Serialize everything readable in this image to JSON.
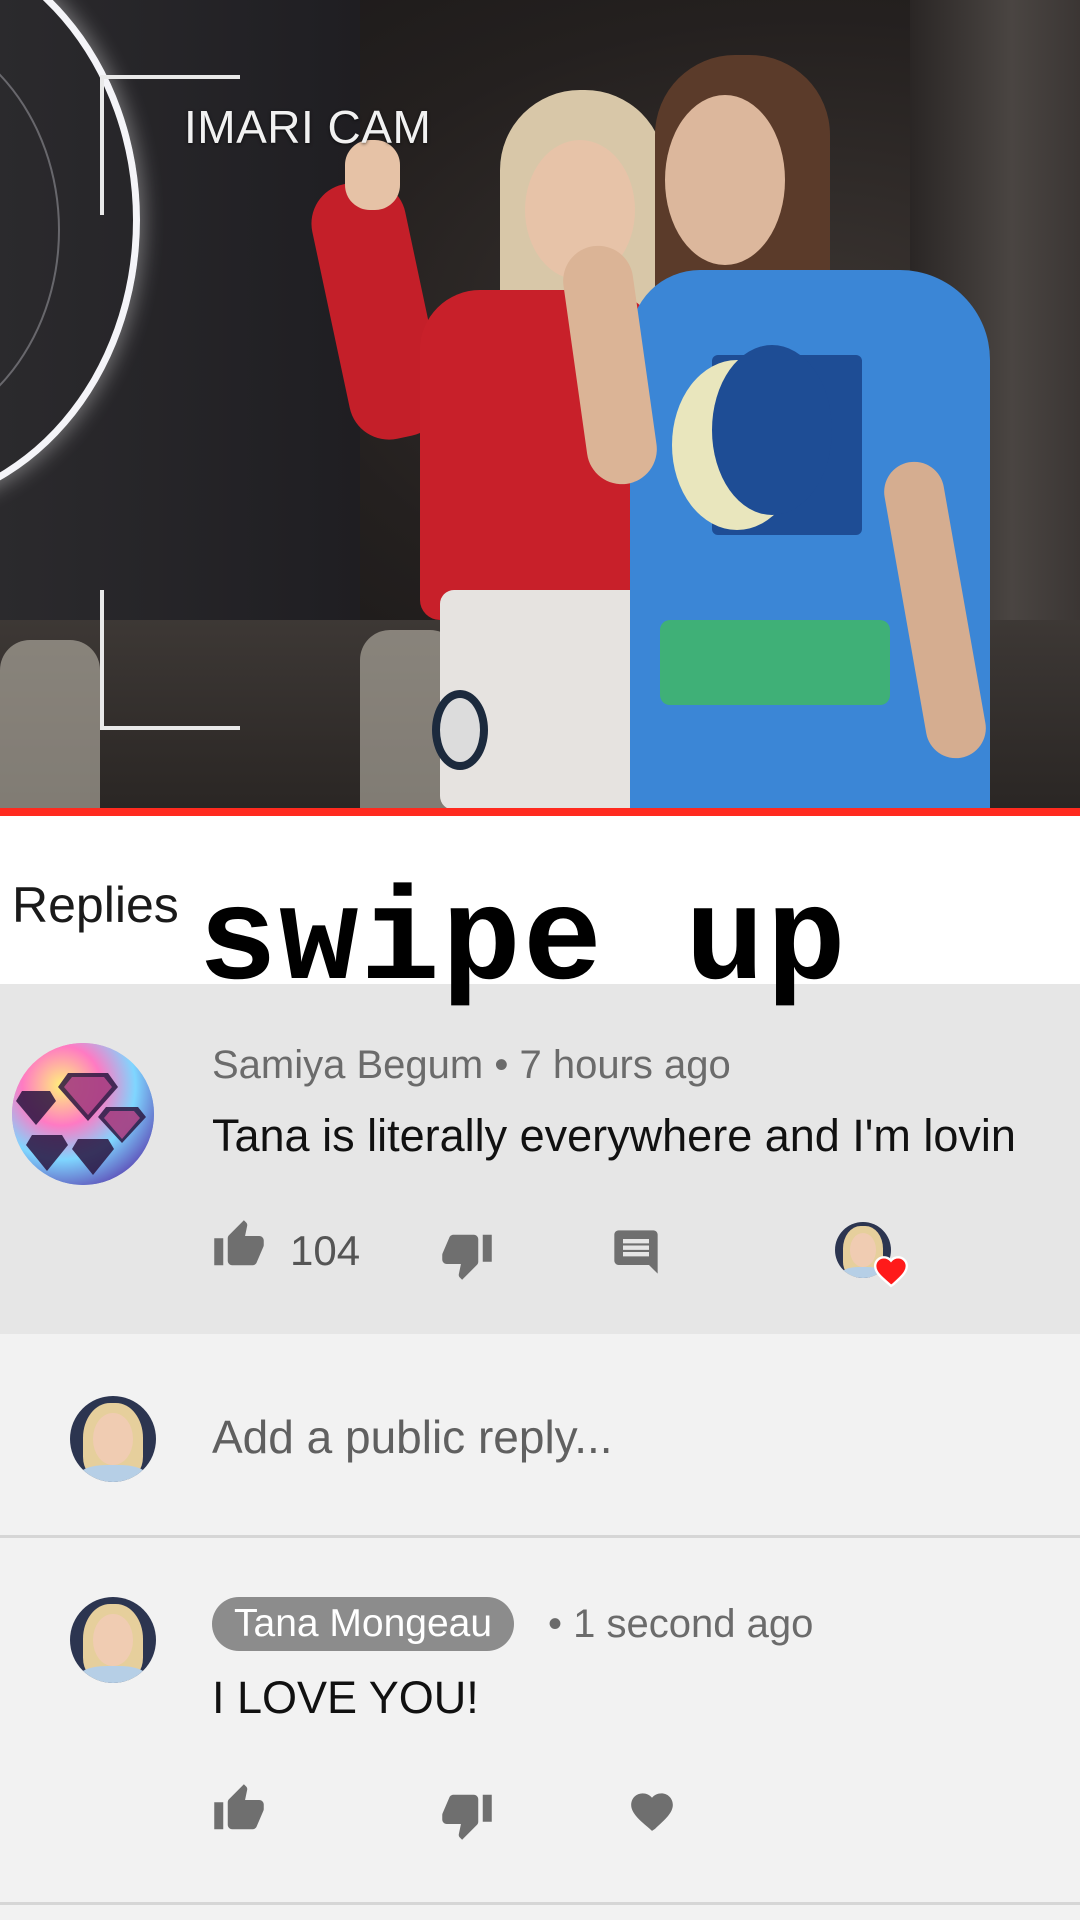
{
  "video": {
    "overlay_label": "IMARI CAM",
    "progress_color": "#ff2a1f"
  },
  "replies_header": {
    "title": "Replies",
    "swipe_label": "swipe up"
  },
  "main_comment": {
    "author": "Samiya Begum",
    "separator": "•",
    "time": "7 hours ago",
    "author_line": "Samiya Begum • 7 hours ago",
    "text": "Tana is literally everywhere and I'm lovin",
    "like_count": "104",
    "icons": [
      "thumbs-up-icon",
      "thumbs-down-icon",
      "reply-icon",
      "creator-heart-icon"
    ]
  },
  "reply_input": {
    "placeholder": "Add a public reply..."
  },
  "reply": {
    "author": "Tana Mongeau",
    "time": "• 1 second ago",
    "text": "I LOVE YOU!",
    "icons": [
      "thumbs-up-icon",
      "thumbs-down-icon",
      "heart-icon"
    ]
  },
  "colors": {
    "accent_red": "#ff2a1f",
    "highlight_bg": "#e6e6e6",
    "page_bg": "#f2f2f2",
    "chip_bg": "#8c8c8c",
    "icon_gray": "#7a7a7a"
  }
}
